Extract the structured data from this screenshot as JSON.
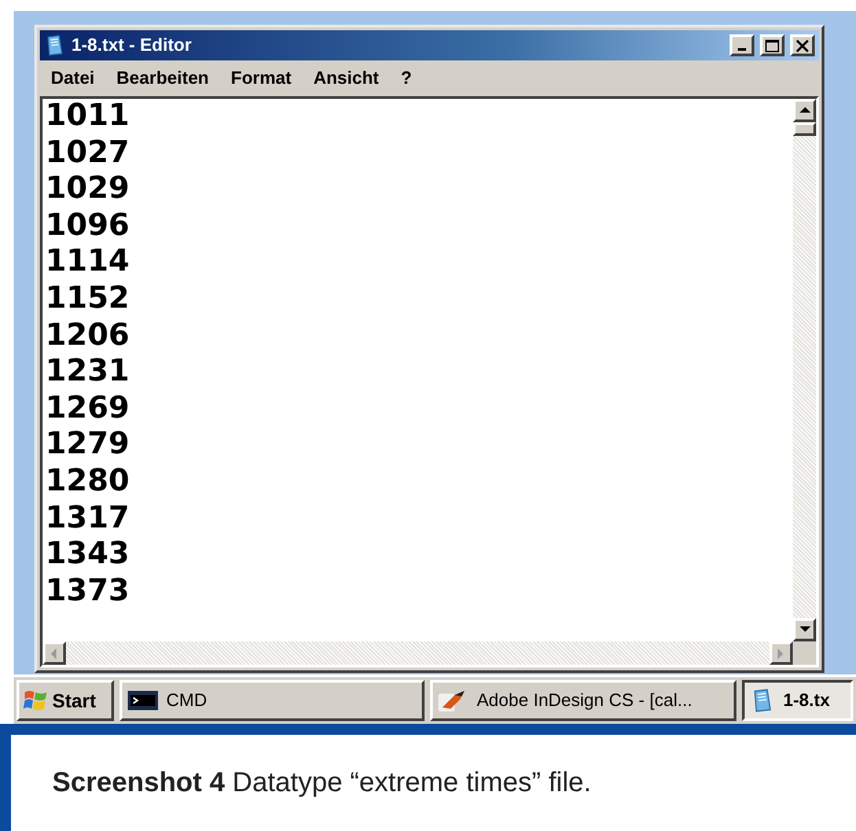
{
  "window": {
    "title": "1-8.txt - Editor"
  },
  "menu": [
    "Datei",
    "Bearbeiten",
    "Format",
    "Ansicht",
    "?"
  ],
  "lines": [
    "1011",
    "1027",
    "1029",
    "1096",
    "1114",
    "1152",
    "1206",
    "1231",
    "1269",
    "1279",
    "1280",
    "1317",
    "1343",
    "1373"
  ],
  "taskbar": {
    "start": "Start",
    "buttons": [
      {
        "label": "CMD",
        "kind": "console",
        "selected": false
      },
      {
        "label": "Adobe InDesign CS - [cal...",
        "kind": "indesign",
        "selected": false
      },
      {
        "label": "1-8.tx",
        "kind": "notepad",
        "selected": true
      }
    ]
  },
  "caption": "**Screenshot 4** Datatype “extreme times” file."
}
